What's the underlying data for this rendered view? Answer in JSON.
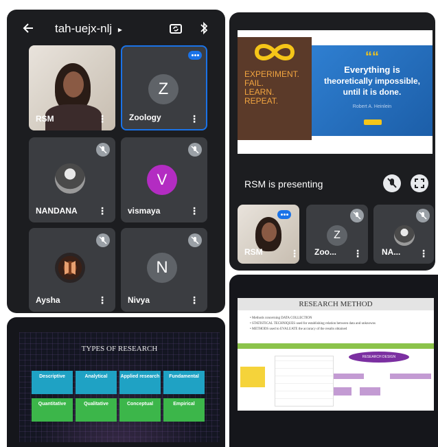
{
  "header": {
    "meeting_code": "tah-uejx-nlj",
    "code_chevron": "▸",
    "back_icon": "arrow-left-icon",
    "switch_camera_icon": "switch-camera-icon",
    "bluetooth_icon": "bluetooth-icon"
  },
  "participants_grid": {
    "tiles": [
      {
        "name": "RSM",
        "type": "camera"
      },
      {
        "name": "Zoology",
        "initial": "Z",
        "avatar_color": "#5f6368",
        "speaking": true
      },
      {
        "name": "NANDANA",
        "type": "photo",
        "muted": true
      },
      {
        "name": "vismaya",
        "initial": "V",
        "avatar_color": "#b32cc2",
        "muted": true
      },
      {
        "name": "Aysha",
        "type": "logo",
        "muted": true
      },
      {
        "name": "Nivya",
        "initial": "N",
        "avatar_color": "#5f6368",
        "muted": true
      }
    ]
  },
  "presentation": {
    "slide": {
      "left_lines": [
        "EXPERIMENT.",
        "FAIL.",
        "LEARN.",
        "REPEAT."
      ],
      "quote_mark": "““",
      "quote_lines": [
        "Everything is",
        "theoretically impossible,",
        "until it is done."
      ],
      "attribution": "Robert A. Heinlein"
    },
    "presenting_label": "RSM is presenting",
    "mini_tiles": [
      {
        "name": "RSM",
        "type": "camera",
        "speaking": true
      },
      {
        "name": "Zoo...",
        "initial": "Z",
        "muted": true
      },
      {
        "name": "NA...",
        "type": "photo",
        "muted": true
      }
    ]
  },
  "types_slide": {
    "title": "TYPES OF RESEARCH",
    "cells": [
      {
        "title": "Descriptive",
        "color": "#1fa2c4"
      },
      {
        "title": "Analytical",
        "color": "#1fa2c4"
      },
      {
        "title": "Applied research",
        "color": "#1fa2c4"
      },
      {
        "title": "Fundamental",
        "color": "#1fa2c4"
      },
      {
        "title": "Quantitative",
        "color": "#3cb64a"
      },
      {
        "title": "Qualitative",
        "color": "#3cb64a"
      },
      {
        "title": "Conceptual",
        "color": "#3cb64a"
      },
      {
        "title": "Empirical",
        "color": "#3cb64a"
      }
    ]
  },
  "method_slide": {
    "title": "RESEARCH METHOD",
    "bullets": [
      "Methods concerning DATA COLLECTION",
      "STATISTICAL TECHNIQUES used for establishing relation between data and unknowns",
      "METHODS used to EVALUATE the accuracy of the results obtained"
    ],
    "box_label": "RESEARCH DESIGN"
  }
}
